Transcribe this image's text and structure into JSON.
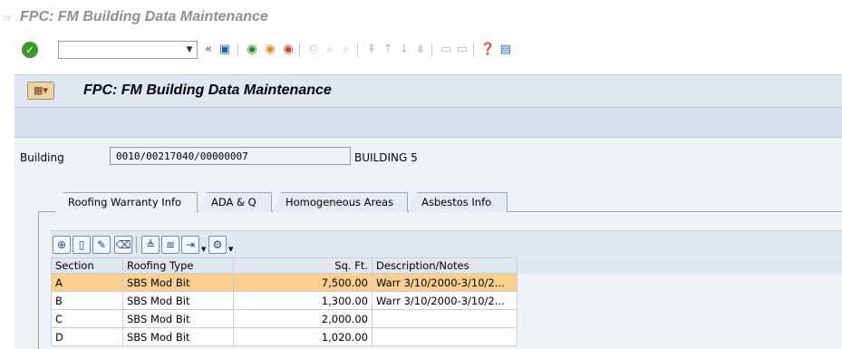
{
  "window": {
    "title": "FPC: FM Building Data Maintenance"
  },
  "toolbar": {
    "command_value": "",
    "back_double_arrow": "«"
  },
  "header": {
    "heading": "FPC: FM Building Data Maintenance"
  },
  "building": {
    "label": "Building",
    "value": "0010/00217040/00000007",
    "name": "BUILDING 5"
  },
  "tabs": [
    {
      "label": "Roofing Warranty Info",
      "active": true
    },
    {
      "label": "ADA & Q",
      "active": false
    },
    {
      "label": "Homogeneous Areas",
      "active": false
    },
    {
      "label": "Asbestos Info",
      "active": false
    }
  ],
  "table": {
    "columns": [
      "Section",
      "Roofing Type",
      "Sq. Ft.",
      "Description/Notes"
    ],
    "rows": [
      {
        "section": "A",
        "type": "SBS Mod Bit",
        "sqft": "7,500.00",
        "notes": "Warr 3/10/2000-3/10/2...",
        "selected": true
      },
      {
        "section": "B",
        "type": "SBS Mod Bit",
        "sqft": "1,300.00",
        "notes": "Warr 3/10/2000-3/10/2...",
        "selected": false
      },
      {
        "section": "C",
        "type": "SBS Mod Bit",
        "sqft": "2,000.00",
        "notes": "",
        "selected": false
      },
      {
        "section": "D",
        "type": "SBS Mod Bit",
        "sqft": "1,020.00",
        "notes": "",
        "selected": false
      }
    ]
  },
  "colors": {
    "header_bg": "#dfe8f1",
    "selected_row": "#fbd08c",
    "ok_green": "#3a9b2a"
  }
}
